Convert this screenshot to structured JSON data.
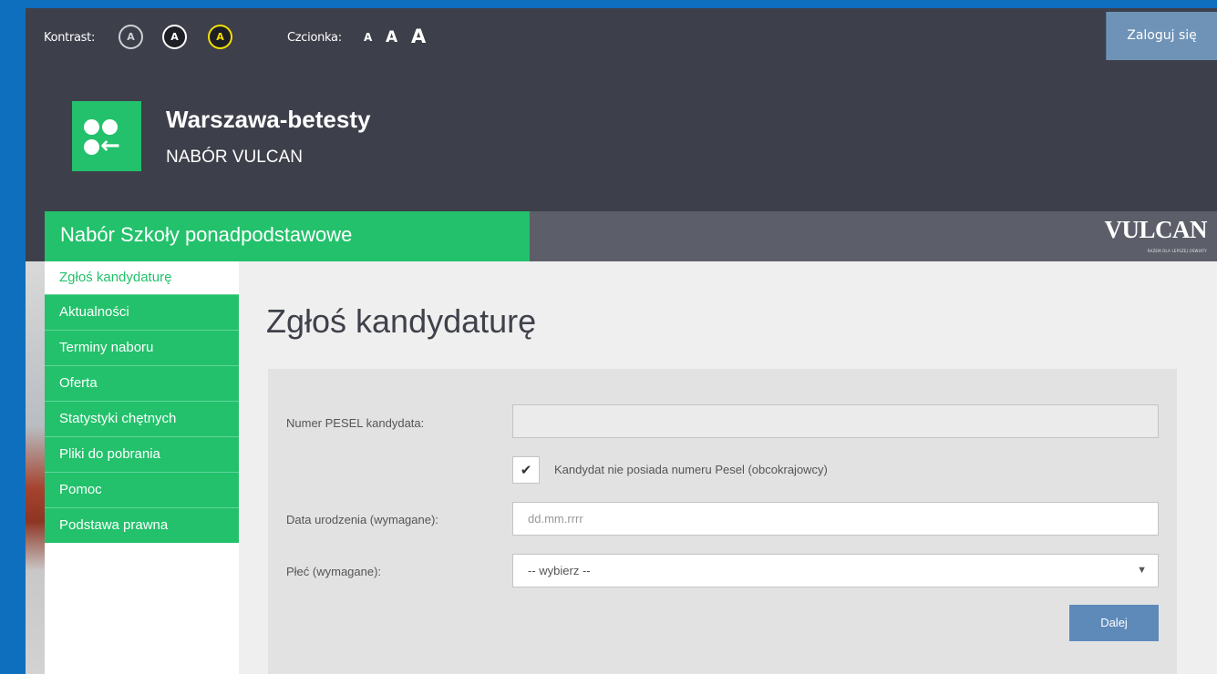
{
  "topbar": {
    "contrast_label": "Kontrast:",
    "contrast_buttons": [
      "A",
      "A",
      "A"
    ],
    "font_label": "Czcionka:",
    "font_buttons": [
      "A",
      "A",
      "A"
    ],
    "login_label": "Zaloguj się"
  },
  "brand": {
    "title": "Warszawa-betesty",
    "subtitle": "NABÓR VULCAN",
    "logo_icon": "vulcan-dots-arrow-icon"
  },
  "header": {
    "section_title": "Nabór Szkoły ponadpodstawowe",
    "vendor_logo": "VULCAN",
    "vendor_tagline": "RAZEM DLA LEPSZEJ OŚWIATY"
  },
  "sidebar": {
    "items": [
      {
        "label": "Zgłoś kandydaturę",
        "active": true
      },
      {
        "label": "Aktualności"
      },
      {
        "label": "Terminy naboru"
      },
      {
        "label": "Oferta"
      },
      {
        "label": "Statystyki chętnych"
      },
      {
        "label": "Pliki do pobrania"
      },
      {
        "label": "Pomoc"
      },
      {
        "label": "Podstawa prawna"
      }
    ]
  },
  "main": {
    "title": "Zgłoś kandydaturę",
    "form": {
      "pesel_label": "Numer PESEL kandydata:",
      "pesel_value": "",
      "no_pesel_label": "Kandydat nie posiada numeru Pesel (obcokrajowcy)",
      "no_pesel_checked": "✔",
      "birth_label": "Data urodzenia (wymagane):",
      "birth_placeholder": "dd.mm.rrrr",
      "gender_label": "Płeć (wymagane):",
      "gender_value": "-- wybierz --",
      "next_label": "Dalej"
    }
  },
  "colors": {
    "brand_green": "#23c16b",
    "dark_bg": "#3d3f4a",
    "button_blue": "#5e8ab9",
    "frame_blue": "#0f6fbf"
  }
}
